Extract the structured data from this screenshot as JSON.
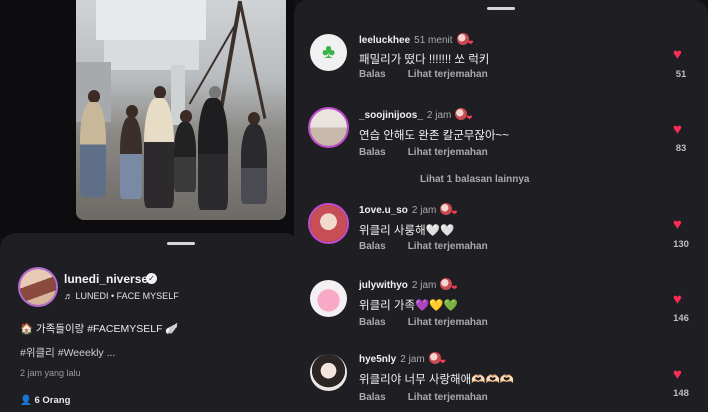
{
  "post": {
    "username": "lunedi_niverse",
    "music": "LUNEDI • FACE MYSELF",
    "caption_line1": "🏠 가족들이랑 #FACEMYSELF 🪽",
    "caption_line2": "#위클리 #Weeekly ...",
    "time_ago": "2 jam yang lalu",
    "people_count": "6 Orang"
  },
  "comments": [
    {
      "user": "leeluckhee",
      "time": "51 menit",
      "text": "패밀리가 떴다 !!!!!!! 쏘 럭키",
      "reply": "Balas",
      "translate": "Lihat terjemahan",
      "likes": "51",
      "avatar": "clover"
    },
    {
      "user": "_soojinijoos_",
      "time": "2 jam",
      "text": "연습 안해도 완존 칼군무잖아~~",
      "reply": "Balas",
      "translate": "Lihat terjemahan",
      "likes": "83",
      "avatar": "person-light"
    },
    {
      "user": "1ove.u_so",
      "time": "2 jam",
      "text": "위클리 사룽해🤍🤍",
      "reply": "Balas",
      "translate": "Lihat terjemahan",
      "likes": "130",
      "avatar": "person-red"
    },
    {
      "user": "julywithyo",
      "time": "2 jam",
      "text": "위클리 가족💜💛💚",
      "reply": "Balas",
      "translate": "Lihat terjemahan",
      "likes": "146",
      "avatar": "pink-character"
    },
    {
      "user": "hye5nly",
      "time": "2 jam",
      "text": "위클리야 너무 사랑해애🫶🏻🫶🏻🫶🏻",
      "reply": "Balas",
      "translate": "",
      "likes": "148",
      "avatar": "person-portrait"
    }
  ],
  "more_replies": "Lihat 1 balasan lainnya",
  "colors": {
    "accent": "#fe2c55",
    "panel": "#1f1f23",
    "background": "#121214"
  }
}
